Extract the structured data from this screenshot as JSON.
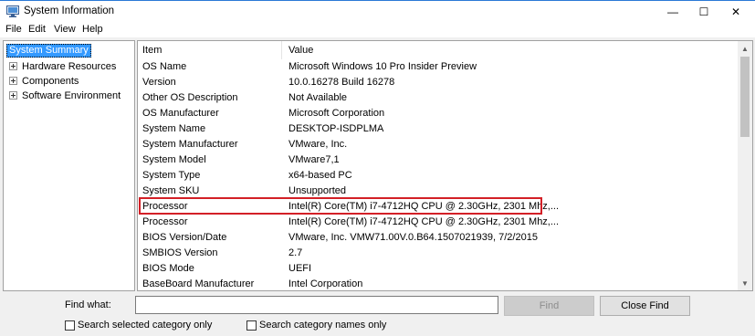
{
  "window": {
    "title": "System Information",
    "min_glyph": "—",
    "max_glyph": "☐",
    "close_glyph": "✕"
  },
  "menu": [
    "File",
    "Edit",
    "View",
    "Help"
  ],
  "tree": {
    "root": "System Summary",
    "children": [
      "Hardware Resources",
      "Components",
      "Software Environment"
    ]
  },
  "table": {
    "headers": {
      "item": "Item",
      "value": "Value"
    },
    "rows": [
      {
        "item": "OS Name",
        "value": "Microsoft Windows 10 Pro Insider Preview"
      },
      {
        "item": "Version",
        "value": "10.0.16278 Build 16278"
      },
      {
        "item": "Other OS Description",
        "value": "Not Available"
      },
      {
        "item": "OS Manufacturer",
        "value": "Microsoft Corporation"
      },
      {
        "item": "System Name",
        "value": "DESKTOP-ISDPLMA"
      },
      {
        "item": "System Manufacturer",
        "value": "VMware, Inc."
      },
      {
        "item": "System Model",
        "value": "VMware7,1"
      },
      {
        "item": "System Type",
        "value": "x64-based PC"
      },
      {
        "item": "System SKU",
        "value": "Unsupported"
      },
      {
        "item": "Processor",
        "value": "Intel(R) Core(TM) i7-4712HQ CPU @ 2.30GHz, 2301 Mhz,..."
      },
      {
        "item": "Processor",
        "value": "Intel(R) Core(TM) i7-4712HQ CPU @ 2.30GHz, 2301 Mhz,..."
      },
      {
        "item": "BIOS Version/Date",
        "value": "VMware, Inc. VMW71.00V.0.B64.1507021939, 7/2/2015"
      },
      {
        "item": "SMBIOS Version",
        "value": "2.7"
      },
      {
        "item": "BIOS Mode",
        "value": "UEFI"
      },
      {
        "item": "BaseBoard Manufacturer",
        "value": "Intel Corporation"
      }
    ]
  },
  "find": {
    "label": "Find what:",
    "value": "",
    "find_button": "Find",
    "close_button": "Close Find",
    "search_selected_label": "Search selected category only",
    "search_names_label": "Search category names only",
    "search_selected_checked": false,
    "search_names_checked": false
  },
  "colors": {
    "highlight_border": "#d32027",
    "selection": "#3399ff"
  }
}
